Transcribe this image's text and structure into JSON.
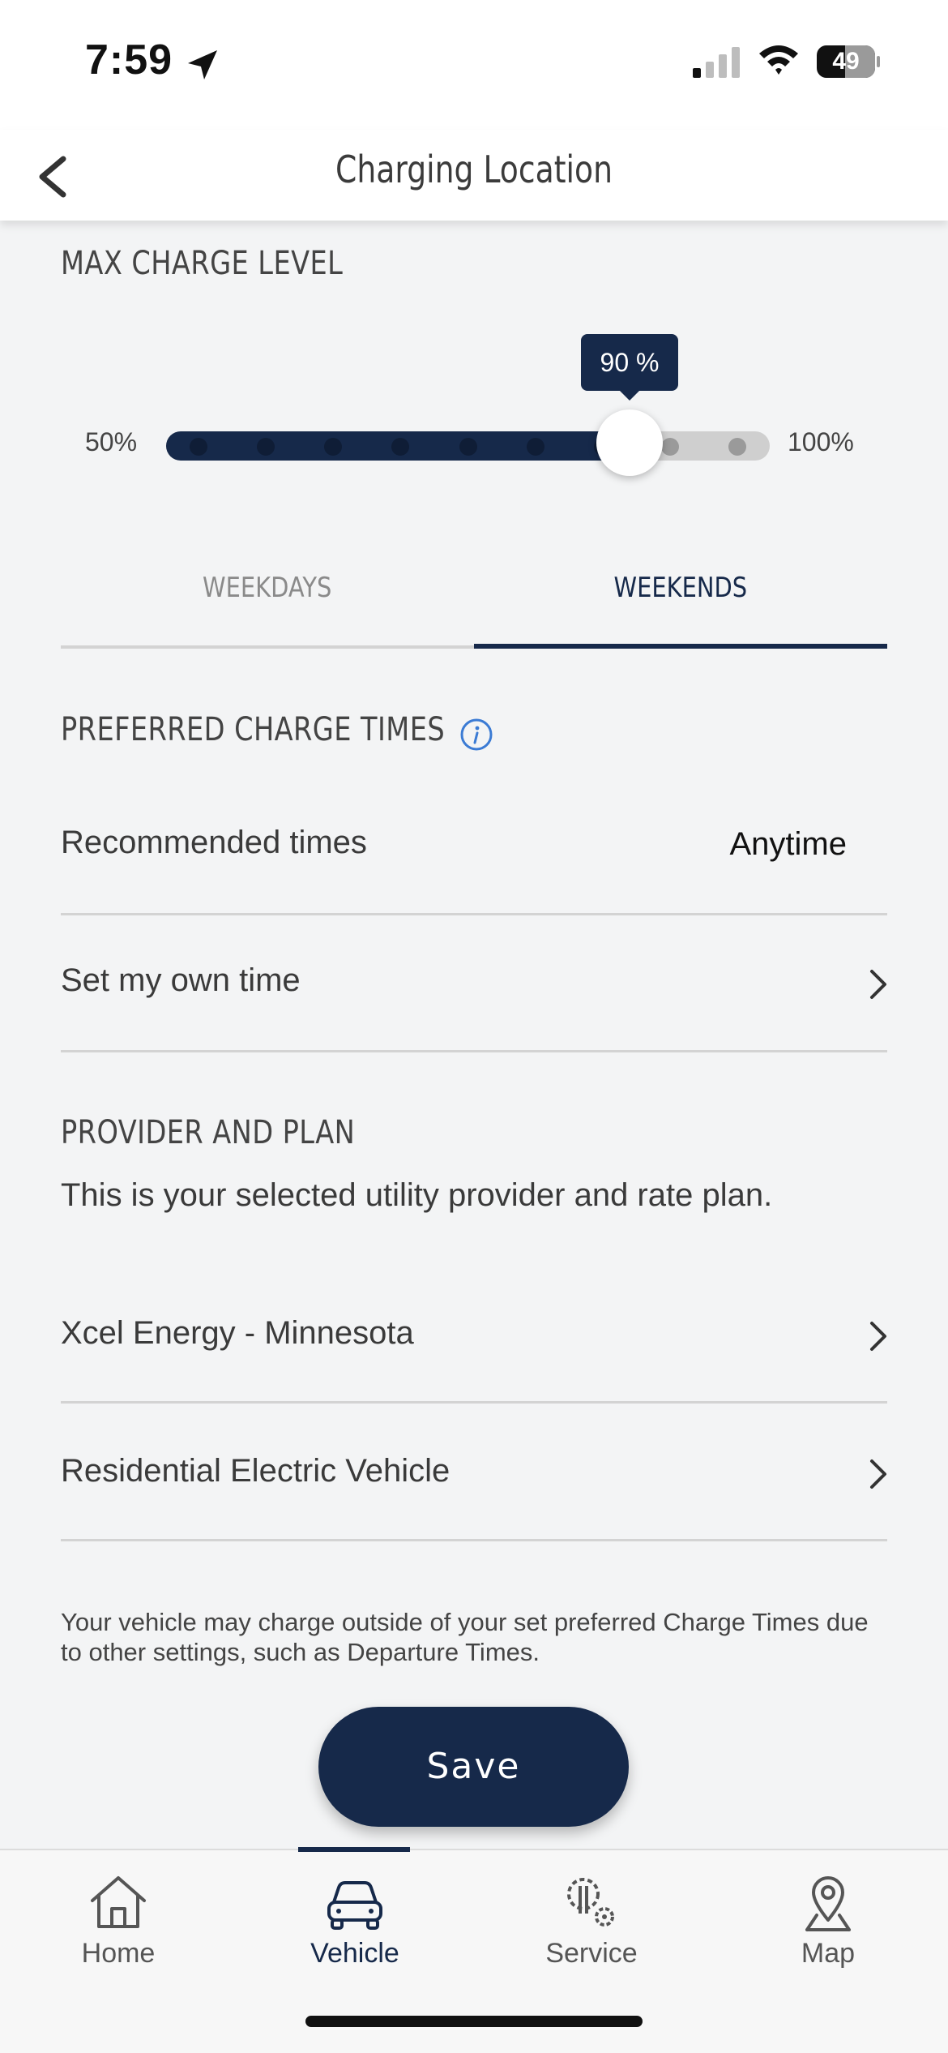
{
  "status_bar": {
    "time": "7:59",
    "battery_level": "49",
    "battery_fraction": 0.49,
    "signal_bars_active": 1
  },
  "header": {
    "title": "Charging Location"
  },
  "max_charge": {
    "section_label": "MAX CHARGE LEVEL",
    "min_label": "50%",
    "max_label": "100%",
    "value_label": "90 %",
    "value_fraction": 0.8,
    "step_count": 9
  },
  "tabs": {
    "weekdays": "WEEKDAYS",
    "weekends": "WEEKENDS",
    "active": "weekends"
  },
  "charge_times": {
    "section_label": "PREFERRED CHARGE TIMES",
    "recommended_label": "Recommended times",
    "recommended_value": "Anytime",
    "own_time_label": "Set my own time"
  },
  "provider": {
    "section_label": "PROVIDER AND PLAN",
    "description": "This is your selected utility provider and rate plan.",
    "provider_name": "Xcel Energy - Minnesota",
    "plan_name": "Residential Electric Vehicle"
  },
  "disclaimer": "Your vehicle may charge outside of your set preferred Charge Times due to other settings, such as Departure Times.",
  "save_label": "Save",
  "nav": {
    "items": [
      {
        "label": "Home",
        "icon": "home-icon"
      },
      {
        "label": "Vehicle",
        "icon": "vehicle-icon"
      },
      {
        "label": "Service",
        "icon": "service-icon"
      },
      {
        "label": "Map",
        "icon": "map-pin-icon"
      }
    ],
    "active": "Vehicle"
  },
  "colors": {
    "brand_navy": "#16294a",
    "info_blue": "#3b7bd4"
  }
}
